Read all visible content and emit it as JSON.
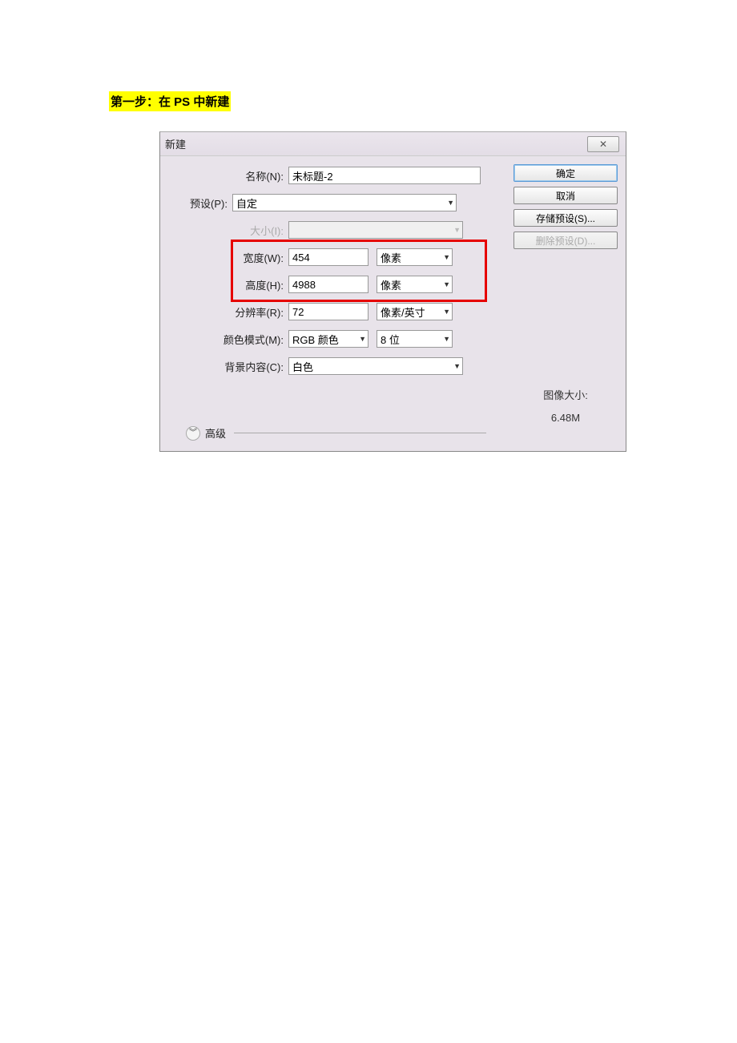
{
  "instruction": "第一步：在 PS 中新建",
  "dialog": {
    "title": "新建",
    "close_glyph": "✕",
    "labels": {
      "name": "名称(N):",
      "preset": "预设(P):",
      "size": "大小(I):",
      "width": "宽度(W):",
      "height": "高度(H):",
      "resolution": "分辨率(R):",
      "color_mode": "颜色模式(M):",
      "bg_content": "背景内容(C):"
    },
    "values": {
      "name": "未标题-2",
      "preset": "自定",
      "size": "",
      "width": "454",
      "width_unit": "像素",
      "height": "4988",
      "height_unit": "像素",
      "resolution": "72",
      "resolution_unit": "像素/英寸",
      "color_mode": "RGB 颜色",
      "bit_depth": "8 位",
      "bg_content": "白色"
    },
    "buttons": {
      "ok": "确定",
      "cancel": "取消",
      "save_preset": "存储预设(S)...",
      "delete_preset": "删除预设(D)..."
    },
    "info": {
      "image_size_label": "图像大小:",
      "image_size_value": "6.48M"
    },
    "advanced": {
      "label": "高级",
      "glyph": "⌄"
    }
  }
}
